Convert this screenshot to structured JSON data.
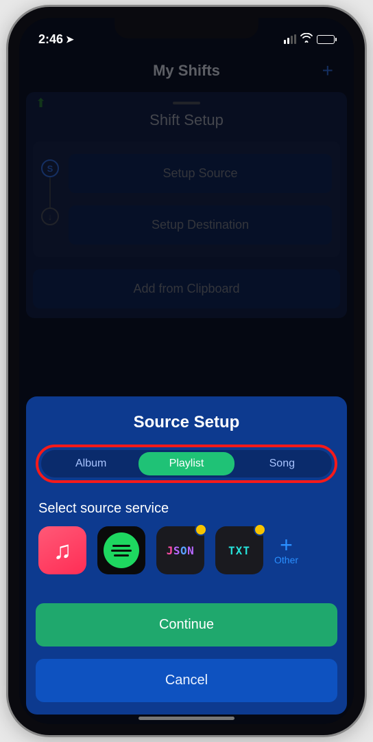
{
  "status": {
    "time": "2:46"
  },
  "background": {
    "header_title": "My Shifts",
    "sheet_title": "Shift Setup",
    "step_source": "Setup Source",
    "step_destination": "Setup Destination",
    "clipboard": "Add from Clipboard"
  },
  "sheet": {
    "title": "Source Setup",
    "segments": {
      "album": "Album",
      "playlist": "Playlist",
      "song": "Song"
    },
    "select_label": "Select source service",
    "services": {
      "json": "JSON",
      "txt": "TXT",
      "other": "Other"
    },
    "continue": "Continue",
    "cancel": "Cancel"
  }
}
